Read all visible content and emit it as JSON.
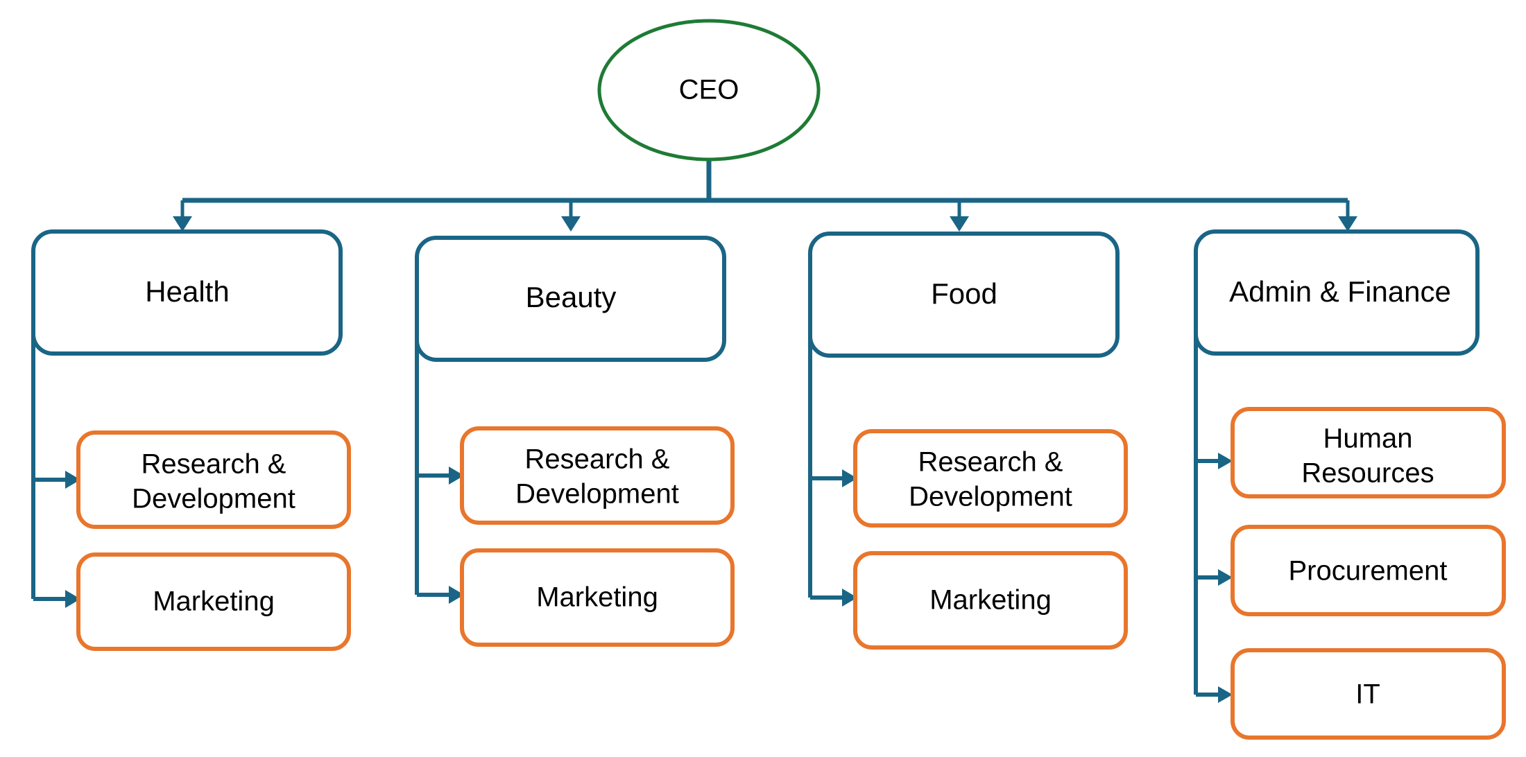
{
  "diagram": {
    "type": "organizational-chart",
    "background_color": "#ffffff",
    "colors": {
      "root_border": "#1e7b34",
      "division_border": "#1a6585",
      "subunit_border": "#e8762c",
      "connector": "#1a6585",
      "node_fill": "#ffffff",
      "text": "#000000"
    }
  },
  "root": {
    "id": "ceo",
    "label": "CEO",
    "shape": "ellipse"
  },
  "divisions": [
    {
      "id": "health",
      "label": "Health",
      "shape": "rounded-rect",
      "children": [
        {
          "id": "health-rd",
          "label": "Research & Development",
          "lines": [
            "Research &",
            "Development"
          ]
        },
        {
          "id": "health-marketing",
          "label": "Marketing",
          "lines": [
            "Marketing"
          ]
        }
      ]
    },
    {
      "id": "beauty",
      "label": "Beauty",
      "shape": "rounded-rect",
      "children": [
        {
          "id": "beauty-rd",
          "label": "Research & Development",
          "lines": [
            "Research &",
            "Development"
          ]
        },
        {
          "id": "beauty-marketing",
          "label": "Marketing",
          "lines": [
            "Marketing"
          ]
        }
      ]
    },
    {
      "id": "food",
      "label": "Food",
      "shape": "rounded-rect",
      "children": [
        {
          "id": "food-rd",
          "label": "Research & Development",
          "lines": [
            "Research &",
            "Development"
          ]
        },
        {
          "id": "food-marketing",
          "label": "Marketing",
          "lines": [
            "Marketing"
          ]
        }
      ]
    },
    {
      "id": "admin-finance",
      "label": "Admin & Finance",
      "shape": "rounded-rect",
      "children": [
        {
          "id": "admin-hr",
          "label": "Human Resources",
          "lines": [
            "Human",
            "Resources"
          ]
        },
        {
          "id": "admin-procurement",
          "label": "Procurement",
          "lines": [
            "Procurement"
          ]
        },
        {
          "id": "admin-it",
          "label": "IT",
          "lines": [
            "IT"
          ]
        }
      ]
    }
  ]
}
